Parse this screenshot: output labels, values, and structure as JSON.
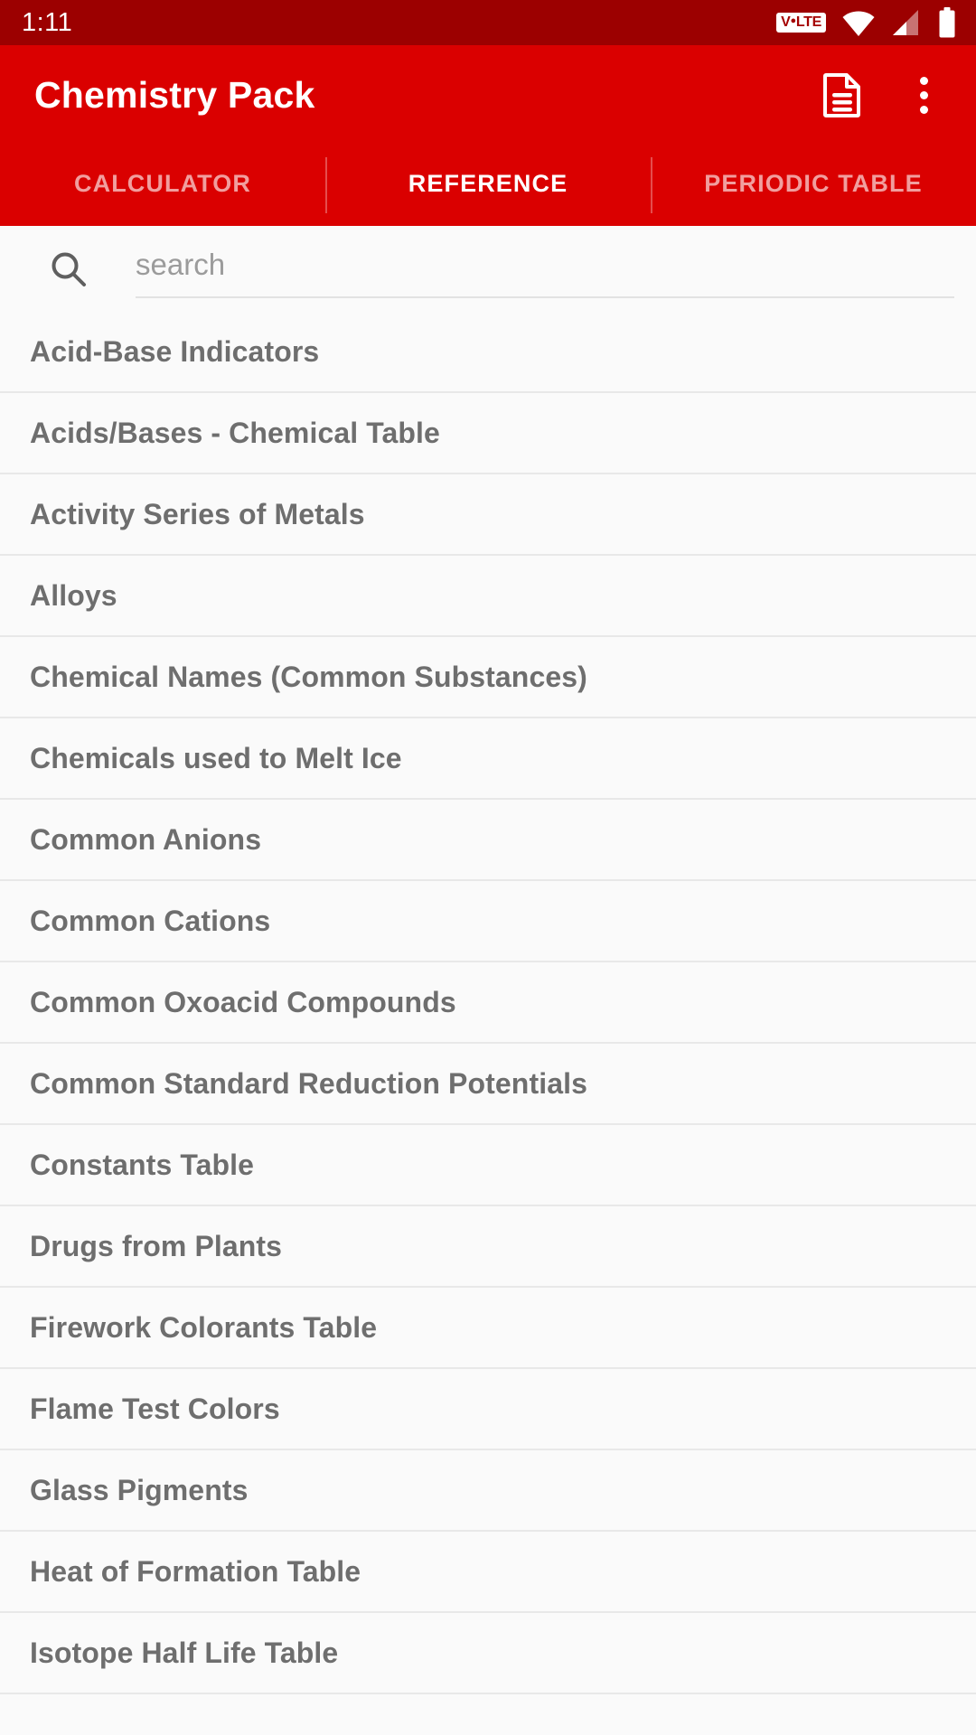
{
  "status_bar": {
    "time": "1:11",
    "icons": [
      "volte-badge",
      "wifi-icon",
      "signal-icon",
      "battery-icon"
    ],
    "volte_label": "VoLTE",
    "background_color": "#9c0000"
  },
  "app_bar": {
    "title": "Chemistry Pack",
    "background_color": "#da0000",
    "actions": [
      {
        "name": "notes-document-icon",
        "label": "Notes"
      },
      {
        "name": "overflow-menu-icon",
        "label": "More options"
      }
    ]
  },
  "tabs": {
    "active_index": 1,
    "items": [
      {
        "label": "CALCULATOR"
      },
      {
        "label": "REFERENCE"
      },
      {
        "label": "PERIODIC TABLE"
      }
    ]
  },
  "search": {
    "placeholder": "search",
    "value": "",
    "icon": "search-icon"
  },
  "reference_list": {
    "items": [
      {
        "label": "Acid-Base Indicators"
      },
      {
        "label": "Acids/Bases - Chemical Table"
      },
      {
        "label": "Activity Series of Metals"
      },
      {
        "label": "Alloys"
      },
      {
        "label": "Chemical Names (Common Substances)"
      },
      {
        "label": "Chemicals used to Melt Ice"
      },
      {
        "label": "Common Anions"
      },
      {
        "label": "Common Cations"
      },
      {
        "label": "Common Oxoacid Compounds"
      },
      {
        "label": "Common Standard Reduction Potentials"
      },
      {
        "label": "Constants Table"
      },
      {
        "label": "Drugs from Plants"
      },
      {
        "label": "Firework Colorants Table"
      },
      {
        "label": "Flame Test Colors"
      },
      {
        "label": "Glass Pigments"
      },
      {
        "label": "Heat of Formation Table"
      },
      {
        "label": "Isotope Half Life Table"
      }
    ]
  },
  "colors": {
    "primary": "#da0000",
    "primary_dark": "#9c0000",
    "background": "#fafafa",
    "text_primary": "#6e6e6e",
    "divider": "#e8e8e8"
  }
}
